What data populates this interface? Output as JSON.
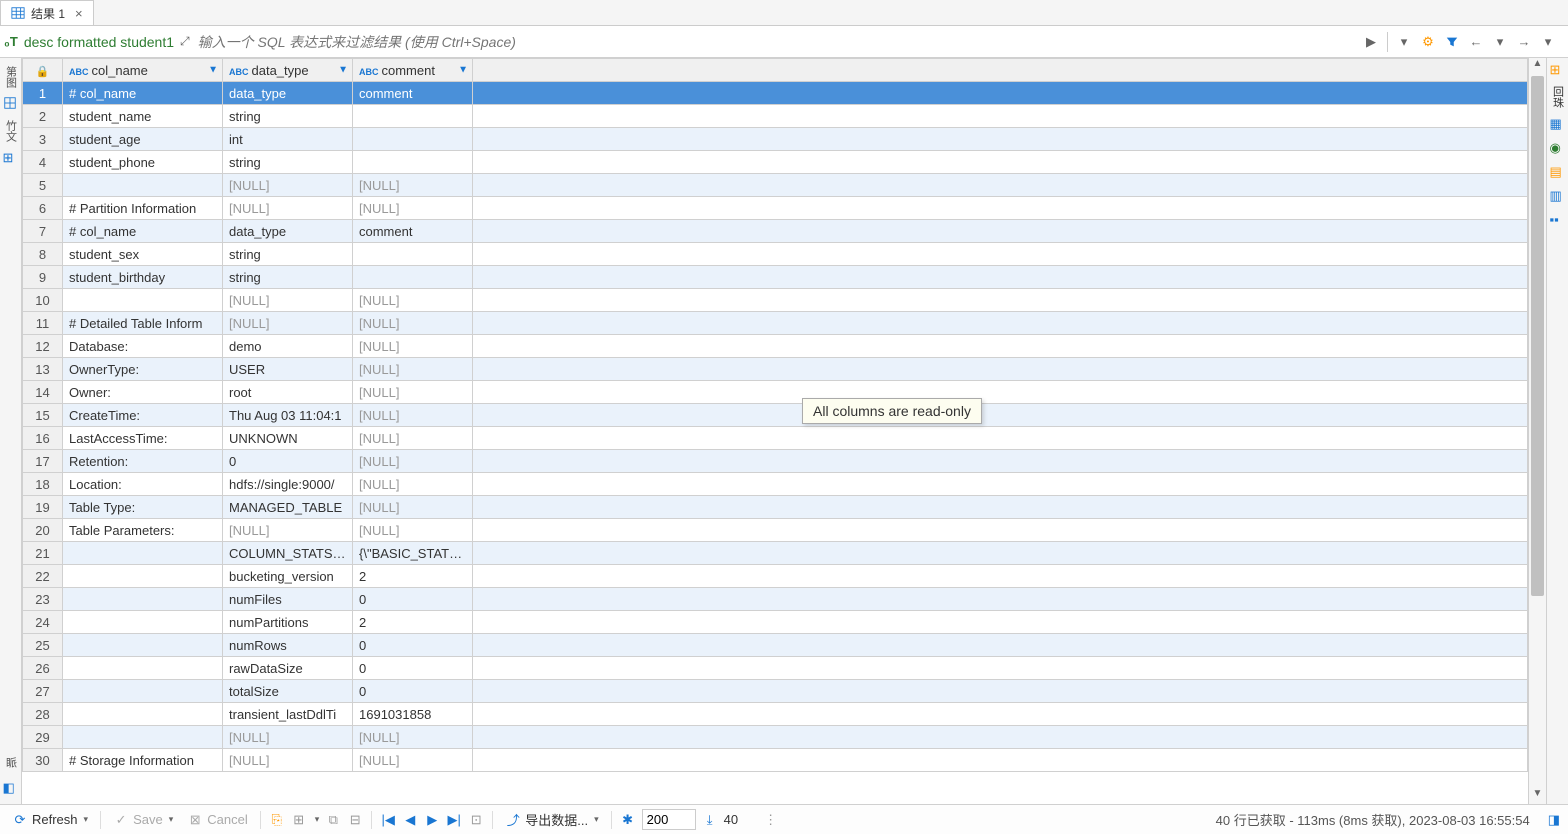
{
  "tab": {
    "title": "结果 1"
  },
  "sql": {
    "text": "desc formatted student1"
  },
  "filter": {
    "placeholder": "输入一个 SQL 表达式来过滤结果 (使用 Ctrl+Space)"
  },
  "columns": [
    {
      "name": "col_name"
    },
    {
      "name": "data_type"
    },
    {
      "name": "comment"
    }
  ],
  "rows": [
    {
      "n": 1,
      "c1": "# col_name",
      "c2": "data_type",
      "c3": "comment",
      "selected": true
    },
    {
      "n": 2,
      "c1": "student_name",
      "c2": "string",
      "c3": ""
    },
    {
      "n": 3,
      "c1": "student_age",
      "c2": "int",
      "c3": ""
    },
    {
      "n": 4,
      "c1": "student_phone",
      "c2": "string",
      "c3": ""
    },
    {
      "n": 5,
      "c1": "",
      "c2": "[NULL]",
      "c3": "[NULL]",
      "null2": true,
      "null3": true
    },
    {
      "n": 6,
      "c1": "# Partition Information",
      "c2": "[NULL]",
      "c3": "[NULL]",
      "null2": true,
      "null3": true
    },
    {
      "n": 7,
      "c1": "# col_name",
      "c2": "data_type",
      "c3": "comment"
    },
    {
      "n": 8,
      "c1": "student_sex",
      "c2": "string",
      "c3": ""
    },
    {
      "n": 9,
      "c1": "student_birthday",
      "c2": "string",
      "c3": ""
    },
    {
      "n": 10,
      "c1": "",
      "c2": "[NULL]",
      "c3": "[NULL]",
      "null2": true,
      "null3": true
    },
    {
      "n": 11,
      "c1": "# Detailed Table Inform",
      "c2": "[NULL]",
      "c3": "[NULL]",
      "null2": true,
      "null3": true
    },
    {
      "n": 12,
      "c1": "Database:",
      "c2": "demo",
      "c3": "[NULL]",
      "null3": true
    },
    {
      "n": 13,
      "c1": "OwnerType:",
      "c2": "USER",
      "c3": "[NULL]",
      "null3": true
    },
    {
      "n": 14,
      "c1": "Owner:",
      "c2": "root",
      "c3": "[NULL]",
      "null3": true
    },
    {
      "n": 15,
      "c1": "CreateTime:",
      "c2": "Thu Aug 03 11:04:1",
      "c3": "[NULL]",
      "null3": true
    },
    {
      "n": 16,
      "c1": "LastAccessTime:",
      "c2": "UNKNOWN",
      "c3": "[NULL]",
      "null3": true
    },
    {
      "n": 17,
      "c1": "Retention:",
      "c2": "0",
      "c3": "[NULL]",
      "null3": true
    },
    {
      "n": 18,
      "c1": "Location:",
      "c2": "hdfs://single:9000/",
      "c3": "[NULL]",
      "null3": true
    },
    {
      "n": 19,
      "c1": "Table Type:",
      "c2": "MANAGED_TABLE",
      "c3": "[NULL]",
      "null3": true
    },
    {
      "n": 20,
      "c1": "Table Parameters:",
      "c2": "[NULL]",
      "c3": "[NULL]",
      "null2": true,
      "null3": true
    },
    {
      "n": 21,
      "c1": "",
      "c2": "COLUMN_STATS_A",
      "c3": "{\\\"BASIC_STATS\\\":"
    },
    {
      "n": 22,
      "c1": "",
      "c2": "bucketing_version",
      "c3": "2"
    },
    {
      "n": 23,
      "c1": "",
      "c2": "numFiles",
      "c3": "0"
    },
    {
      "n": 24,
      "c1": "",
      "c2": "numPartitions",
      "c3": "2"
    },
    {
      "n": 25,
      "c1": "",
      "c2": "numRows",
      "c3": "0"
    },
    {
      "n": 26,
      "c1": "",
      "c2": "rawDataSize",
      "c3": "0"
    },
    {
      "n": 27,
      "c1": "",
      "c2": "totalSize",
      "c3": "0"
    },
    {
      "n": 28,
      "c1": "",
      "c2": "transient_lastDdlTi",
      "c3": "1691031858"
    },
    {
      "n": 29,
      "c1": "",
      "c2": "[NULL]",
      "c3": "[NULL]",
      "null2": true,
      "null3": true
    },
    {
      "n": 30,
      "c1": "# Storage Information",
      "c2": "[NULL]",
      "c3": "[NULL]",
      "null2": true,
      "null3": true
    }
  ],
  "tooltip": "All columns are read-only",
  "bottom": {
    "refresh": "Refresh",
    "save": "Save",
    "cancel": "Cancel",
    "export": "导出数据...",
    "page_size": "200",
    "total": "40",
    "status": "40 行已获取 - 113ms (8ms 获取), 2023-08-03 16:55:54"
  },
  "leftside": {
    "label1": "第图",
    "label2": "竹文"
  }
}
